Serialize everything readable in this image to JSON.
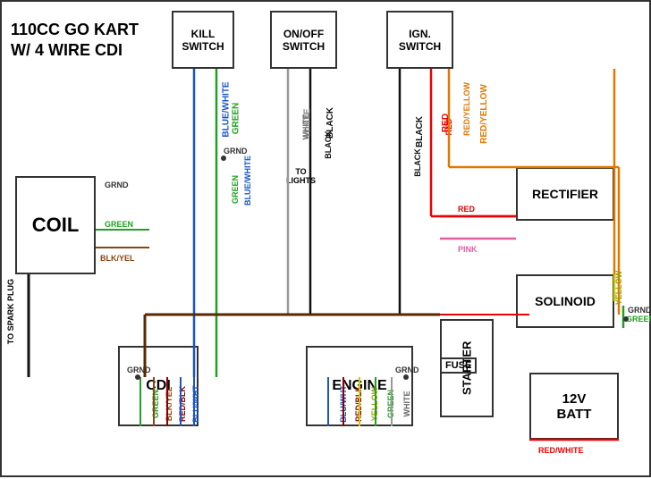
{
  "title": {
    "line1": "110CC GO KART",
    "line2": "W/ 4 WIRE CDI"
  },
  "boxes": {
    "coil": "COIL",
    "kill_switch": "KILL\nSWITCH",
    "onoff_switch": "ON/OFF\nSWITCH",
    "ign_switch": "IGN.\nSWITCH",
    "cdi": "CDI",
    "engine": "ENGINE",
    "starter": "STARTER",
    "rectifier": "RECTIFIER",
    "solenoid": "SOLINOID",
    "battery": "12V\nBATT"
  },
  "labels": {
    "to_spark_plug": "TO SPARK PLUG",
    "to_lights": "TO\nLIGHTS",
    "fuse": "FUSE",
    "grnd": "GRND",
    "red_white": "RED/WHITE"
  },
  "wire_labels": {
    "blue_white": "BLUE/WHITE",
    "green": "GREEN",
    "white": "WHITE",
    "black": "BLACK",
    "black2": "BLACK",
    "red": "RED",
    "red_yellow": "RED/YELLOW",
    "green_coil": "GREEN",
    "blk_yel": "BLK/YEL",
    "red_pink": "RED",
    "pink": "PINK",
    "yellow_sol": "YELLOW",
    "green_sol": "GREEN",
    "green_bot": "GREEN",
    "blk_yel_bot": "BLK/YEL",
    "red_blk": "RED/BLK",
    "blu_wht": "BLU/WHT",
    "red_blk2": "RED/BLK",
    "yellow_bot": "YELLOW",
    "green_bot2": "GREEN",
    "white_bot": "WHITE",
    "blu_wht_bot": "BLU/WHT"
  },
  "colors": {
    "blue": "#1a56c4",
    "green": "#22a022",
    "red": "#e00",
    "orange": "#e07800",
    "yellow": "#cccc00",
    "pink": "#e060a0",
    "black": "#111",
    "dark_brown": "#5a2800",
    "brown": "#8B4513"
  }
}
